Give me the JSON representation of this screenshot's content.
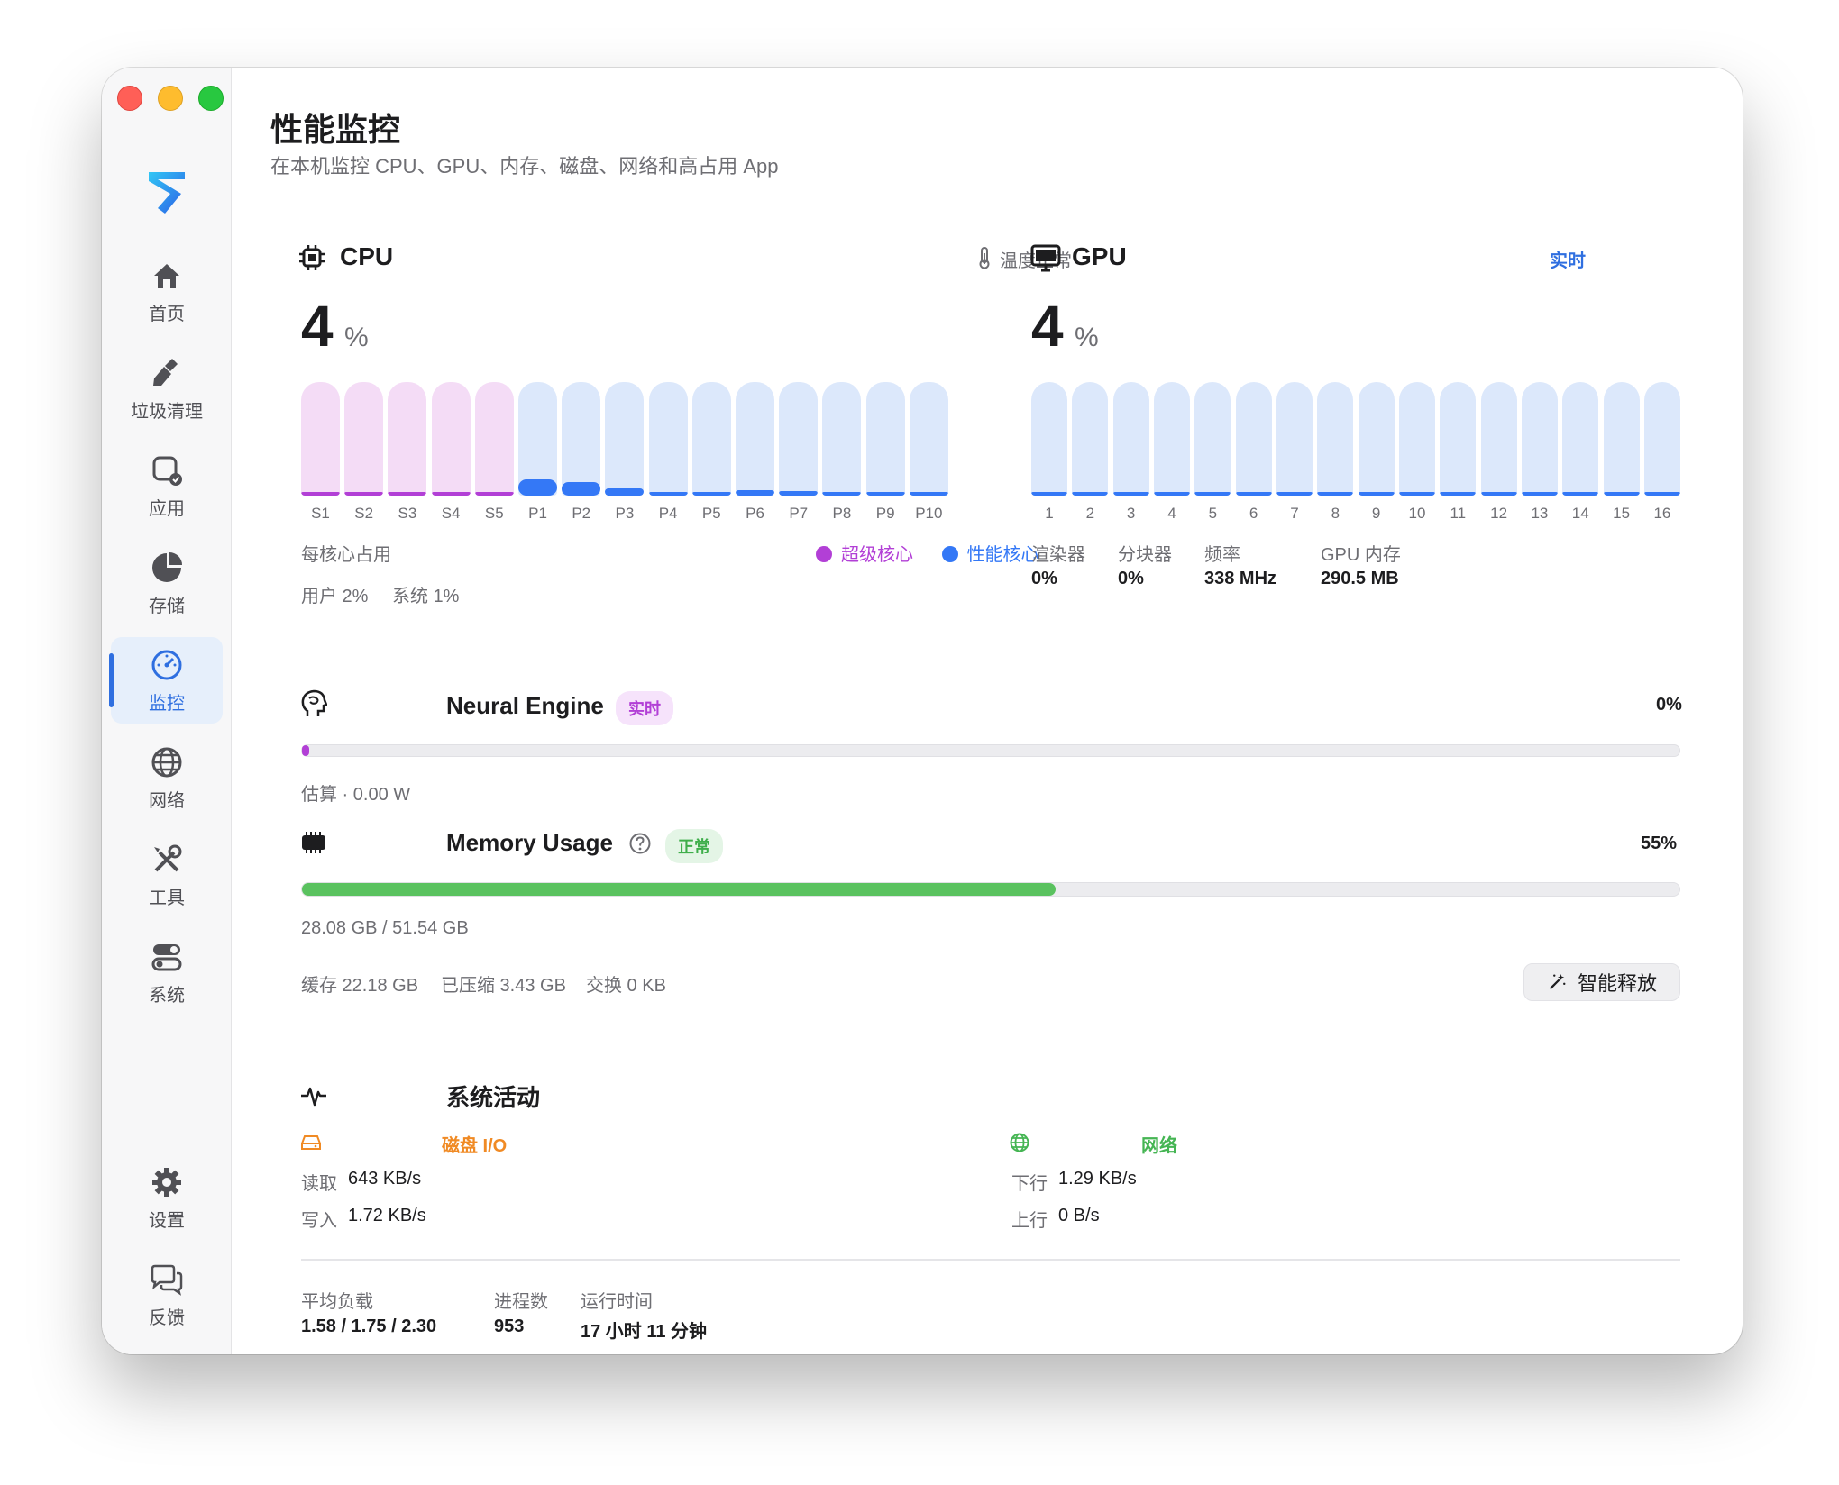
{
  "sidebar": {
    "items": [
      {
        "name": "home",
        "label": "首页",
        "icon": "home-icon"
      },
      {
        "name": "cleanup",
        "label": "垃圾清理",
        "icon": "broom-icon"
      },
      {
        "name": "apps",
        "label": "应用",
        "icon": "apps-icon"
      },
      {
        "name": "storage",
        "label": "存储",
        "icon": "pie-icon"
      },
      {
        "name": "monitor",
        "label": "监控",
        "icon": "gauge-icon",
        "active": true
      },
      {
        "name": "network",
        "label": "网络",
        "icon": "globe-icon"
      },
      {
        "name": "tools",
        "label": "工具",
        "icon": "wrench-icon"
      },
      {
        "name": "system",
        "label": "系统",
        "icon": "toggle-icon"
      }
    ],
    "bottom": [
      {
        "name": "settings",
        "label": "设置",
        "icon": "gear-icon"
      },
      {
        "name": "feedback",
        "label": "反馈",
        "icon": "chat-icon"
      }
    ]
  },
  "header": {
    "title": "性能监控",
    "subtitle": "在本机监控 CPU、GPU、内存、磁盘、网络和高占用 App"
  },
  "cpu": {
    "title": "CPU",
    "status": "温度正常",
    "value": "4",
    "unit": "%",
    "per_core_label": "每核心占用",
    "legend_super": "超级核心",
    "legend_perf": "性能核心",
    "user": "用户 2%",
    "system": "系统 1%",
    "super_color": "#b23fd6",
    "perf_color": "#3478f6",
    "cores": [
      {
        "label": "S1",
        "type": "super",
        "usage": 0.02
      },
      {
        "label": "S2",
        "type": "super",
        "usage": 0.02
      },
      {
        "label": "S3",
        "type": "super",
        "usage": 0.02
      },
      {
        "label": "S4",
        "type": "super",
        "usage": 0.02
      },
      {
        "label": "S5",
        "type": "super",
        "usage": 0.02
      },
      {
        "label": "P1",
        "type": "perf",
        "usage": 0.14
      },
      {
        "label": "P2",
        "type": "perf",
        "usage": 0.12
      },
      {
        "label": "P3",
        "type": "perf",
        "usage": 0.06
      },
      {
        "label": "P4",
        "type": "perf",
        "usage": 0.03
      },
      {
        "label": "P5",
        "type": "perf",
        "usage": 0.02
      },
      {
        "label": "P6",
        "type": "perf",
        "usage": 0.05
      },
      {
        "label": "P7",
        "type": "perf",
        "usage": 0.04
      },
      {
        "label": "P8",
        "type": "perf",
        "usage": 0.03
      },
      {
        "label": "P9",
        "type": "perf",
        "usage": 0.02
      },
      {
        "label": "P10",
        "type": "perf",
        "usage": 0.03
      }
    ]
  },
  "gpu": {
    "title": "GPU",
    "status": "实时",
    "value": "4",
    "unit": "%",
    "cores": [
      {
        "label": "1",
        "usage": 0.03
      },
      {
        "label": "2",
        "usage": 0.03
      },
      {
        "label": "3",
        "usage": 0.03
      },
      {
        "label": "4",
        "usage": 0.03
      },
      {
        "label": "5",
        "usage": 0.03
      },
      {
        "label": "6",
        "usage": 0.03
      },
      {
        "label": "7",
        "usage": 0.03
      },
      {
        "label": "8",
        "usage": 0.03
      },
      {
        "label": "9",
        "usage": 0.03
      },
      {
        "label": "10",
        "usage": 0.03
      },
      {
        "label": "11",
        "usage": 0.03
      },
      {
        "label": "12",
        "usage": 0.03
      },
      {
        "label": "13",
        "usage": 0.03
      },
      {
        "label": "14",
        "usage": 0.03
      },
      {
        "label": "15",
        "usage": 0.03
      },
      {
        "label": "16",
        "usage": 0.03
      }
    ],
    "stats": [
      {
        "label": "渲染器",
        "value": "0%"
      },
      {
        "label": "分块器",
        "value": "0%"
      },
      {
        "label": "频率",
        "value": "338 MHz"
      },
      {
        "label": "GPU 内存",
        "value": "290.5 MB"
      }
    ]
  },
  "neural": {
    "title": "Neural Engine",
    "badge": "实时",
    "value": "0%",
    "usage": 0.004,
    "estimate": "估算 · 0.00 W"
  },
  "memory": {
    "title": "Memory Usage",
    "badge": "正常",
    "value": "55%",
    "usage": 0.547,
    "used": "28.08 GB / 51.54 GB",
    "cache": "缓存 22.18 GB",
    "compressed": "已压缩 3.43 GB",
    "swap": "交换 0 KB",
    "release_button": "智能释放",
    "bar_color": "#5ac25f"
  },
  "activity": {
    "title": "系统活动",
    "disk": {
      "title": "磁盘 I/O",
      "read_label": "读取",
      "read": "643 KB/s",
      "write_label": "写入",
      "write": "1.72 KB/s",
      "color": "#f08a24"
    },
    "network": {
      "title": "网络",
      "down_label": "下行",
      "down": "1.29 KB/s",
      "up_label": "上行",
      "up": "0 B/s",
      "color": "#45b553"
    },
    "load_label": "平均负载",
    "load": "1.58 / 1.75 / 2.30",
    "proc_label": "进程数",
    "proc": "953",
    "uptime_label": "运行时间",
    "uptime": "17 小时 11 分钟"
  }
}
